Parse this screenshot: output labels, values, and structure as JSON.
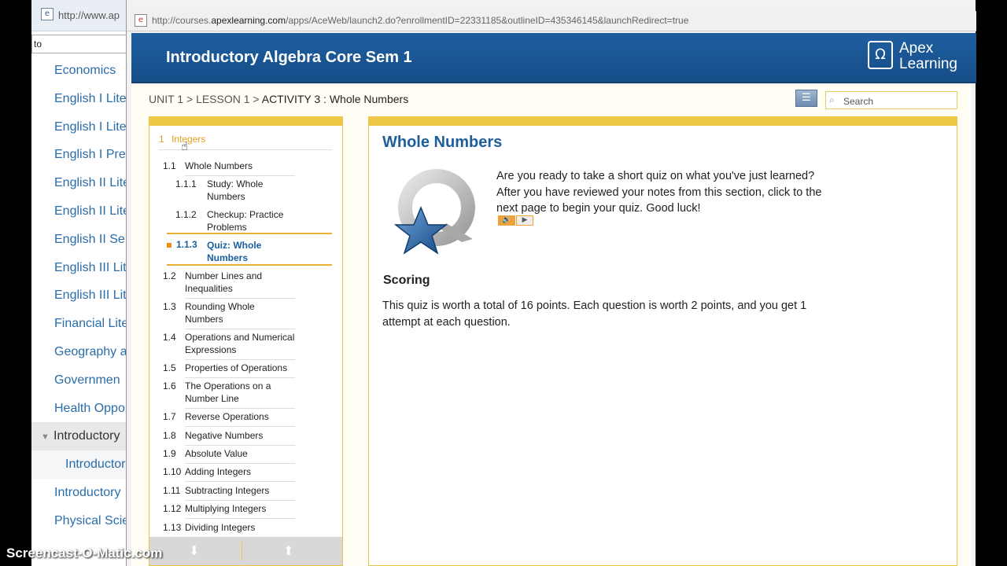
{
  "background_browser": {
    "url": "http://www.ap",
    "search_value": "to",
    "items": [
      {
        "label": "Economics"
      },
      {
        "label": "English I Lite"
      },
      {
        "label": "English I Lite"
      },
      {
        "label": "English I Pre"
      },
      {
        "label": "English II Lite"
      },
      {
        "label": "English II Lite"
      },
      {
        "label": "English II Se"
      },
      {
        "label": "English III Lit"
      },
      {
        "label": "English III Lit"
      },
      {
        "label": "Financial Lite"
      },
      {
        "label": "Geography a"
      },
      {
        "label": "Governmen"
      },
      {
        "label": "Health Oppo"
      },
      {
        "label": "Introductory"
      },
      {
        "label": "Introductor"
      },
      {
        "label": "Introductory"
      },
      {
        "label": "Physical Scie"
      }
    ]
  },
  "popup": {
    "url_prefix": "http://courses.",
    "url_domain": "apexlearning.com",
    "url_rest": "/apps/AceWeb/launch2.do?enrollmentID=22331185&outlineID=435346145&launchRedirect=true",
    "course_title": "Introductory Algebra Core Sem 1",
    "logo_mark": "Ω",
    "logo_line1": "Apex",
    "logo_line2": "Learning",
    "breadcrumb": {
      "unit": "UNIT 1",
      "sep1": " > ",
      "lesson": "LESSON 1",
      "sep2": " > ",
      "activity": "ACTIVITY 3 : Whole Numbers"
    },
    "search_placeholder": "Search"
  },
  "outline": {
    "unit": {
      "num": "1",
      "label": "Integers"
    },
    "lesson_1_1": {
      "num": "1.1",
      "label": "Whole Numbers"
    },
    "activities": [
      {
        "num": "1.1.1",
        "label": "Study: Whole Numbers"
      },
      {
        "num": "1.1.2",
        "label": "Checkup: Practice Problems"
      }
    ],
    "active": {
      "num": "1.1.3",
      "label": "Quiz: Whole Numbers"
    },
    "lessons": [
      {
        "num": "1.2",
        "label": "Number Lines and Inequalities"
      },
      {
        "num": "1.3",
        "label": "Rounding Whole Numbers"
      },
      {
        "num": "1.4",
        "label": "Operations and Numerical Expressions"
      },
      {
        "num": "1.5",
        "label": "Properties of Operations"
      },
      {
        "num": "1.6",
        "label": "The Operations on a Number Line"
      },
      {
        "num": "1.7",
        "label": "Reverse Operations"
      },
      {
        "num": "1.8",
        "label": "Negative Numbers"
      },
      {
        "num": "1.9",
        "label": "Absolute Value"
      },
      {
        "num": "1.10",
        "label": "Adding Integers"
      },
      {
        "num": "1.11",
        "label": "Subtracting Integers"
      },
      {
        "num": "1.12",
        "label": "Multiplying Integers"
      },
      {
        "num": "1.13",
        "label": "Dividing Integers"
      }
    ]
  },
  "article": {
    "title": "Whole Numbers",
    "intro": "Are you ready to take a short quiz on what you've just learned? After you have reviewed your notes from this section, click to the next page to begin your quiz. Good luck!",
    "scoring_heading": "Scoring",
    "scoring_text": "This quiz is worth a total of 16 points. Each question is worth 2 points, and you get 1 attempt at each question."
  },
  "icons": {
    "audio_speaker": "🔊",
    "audio_play": "▶",
    "arrow_down": "⬇",
    "arrow_up": "⬆",
    "list": "☰",
    "search": "⌕",
    "cursor": "☝"
  },
  "watermark": "Screencast-O-Matic.com",
  "colors": {
    "header_blue": "#1e5fa0",
    "title_blue": "#1d5f9a",
    "accent_gold": "#f0c848",
    "active_orange": "#e8901a"
  }
}
